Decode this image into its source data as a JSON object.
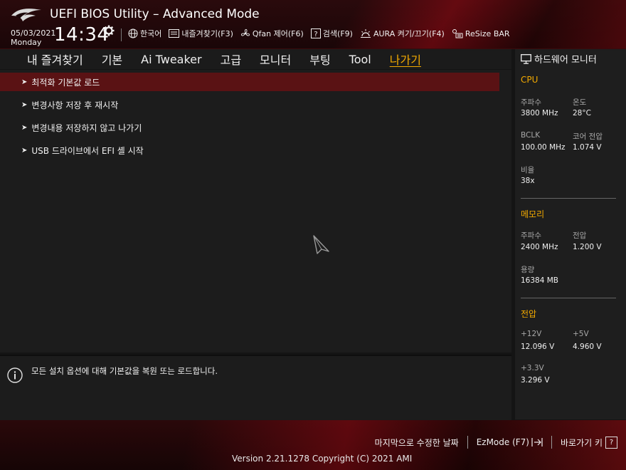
{
  "header": {
    "title": "UEFI BIOS Utility – Advanced Mode",
    "date": "05/03/2021",
    "day": "Monday",
    "time": "14:34",
    "toolbar": [
      {
        "icon": "globe-icon",
        "label": "한국어"
      },
      {
        "icon": "bookmark-icon",
        "label": "내즐겨찾기(F3)"
      },
      {
        "icon": "fan-icon",
        "label": "Qfan 제어(F6)"
      },
      {
        "icon": "help-icon",
        "label": "검색(F9)"
      },
      {
        "icon": "aura-icon",
        "label": "AURA 켜기/끄기(F4)"
      },
      {
        "icon": "resize-bar-icon",
        "label": "ReSize BAR"
      }
    ]
  },
  "tabs": [
    {
      "label": "내 즐겨찾기",
      "active": false
    },
    {
      "label": "기본",
      "active": false
    },
    {
      "label": "Ai Tweaker",
      "active": false
    },
    {
      "label": "고급",
      "active": false
    },
    {
      "label": "모니터",
      "active": false
    },
    {
      "label": "부팅",
      "active": false
    },
    {
      "label": "Tool",
      "active": false
    },
    {
      "label": "나가기",
      "active": true
    }
  ],
  "menu": [
    {
      "label": "최적화 기본값 로드",
      "selected": true
    },
    {
      "label": "변경사항 저장 후 재시작",
      "selected": false
    },
    {
      "label": "변경내용 저장하지 않고  나가기",
      "selected": false
    },
    {
      "label": "USB 드라이브에서 EFI 셸 시작",
      "selected": false
    }
  ],
  "info": {
    "text": "모든 설치 옵션에 대해 기본값을 복원 또는 로드합니다."
  },
  "hw_monitor": {
    "title": "하드웨어 모니터",
    "cpu": {
      "heading": "CPU",
      "freq_label": "주파수",
      "freq_value": "3800 MHz",
      "temp_label": "온도",
      "temp_value": "28°C",
      "bclk_label": "BCLK",
      "bclk_value": "100.00 MHz",
      "core_v_label": "코어 전압",
      "core_v_value": "1.074 V",
      "ratio_label": "비율",
      "ratio_value": "38x"
    },
    "memory": {
      "heading": "메모리",
      "freq_label": "주파수",
      "freq_value": "2400 MHz",
      "volt_label": "전압",
      "volt_value": "1.200 V",
      "cap_label": "용량",
      "cap_value": "16384 MB"
    },
    "voltage": {
      "heading": "전압",
      "v12_label": "+12V",
      "v12_value": "12.096 V",
      "v5_label": "+5V",
      "v5_value": "4.960 V",
      "v33_label": "+3.3V",
      "v33_value": "3.296 V"
    }
  },
  "footer": {
    "last_modified": "마지막으로 수정한 날짜",
    "ezmode": "EzMode (F7)",
    "hotkeys": "바로가기 키",
    "hotkeys_key": "?",
    "version": "Version 2.21.1278 Copyright (C) 2021 AMI"
  },
  "colors": {
    "accent": "#f2a900",
    "selected_row": "#5a1214",
    "brand_red": "#8a0c14"
  }
}
